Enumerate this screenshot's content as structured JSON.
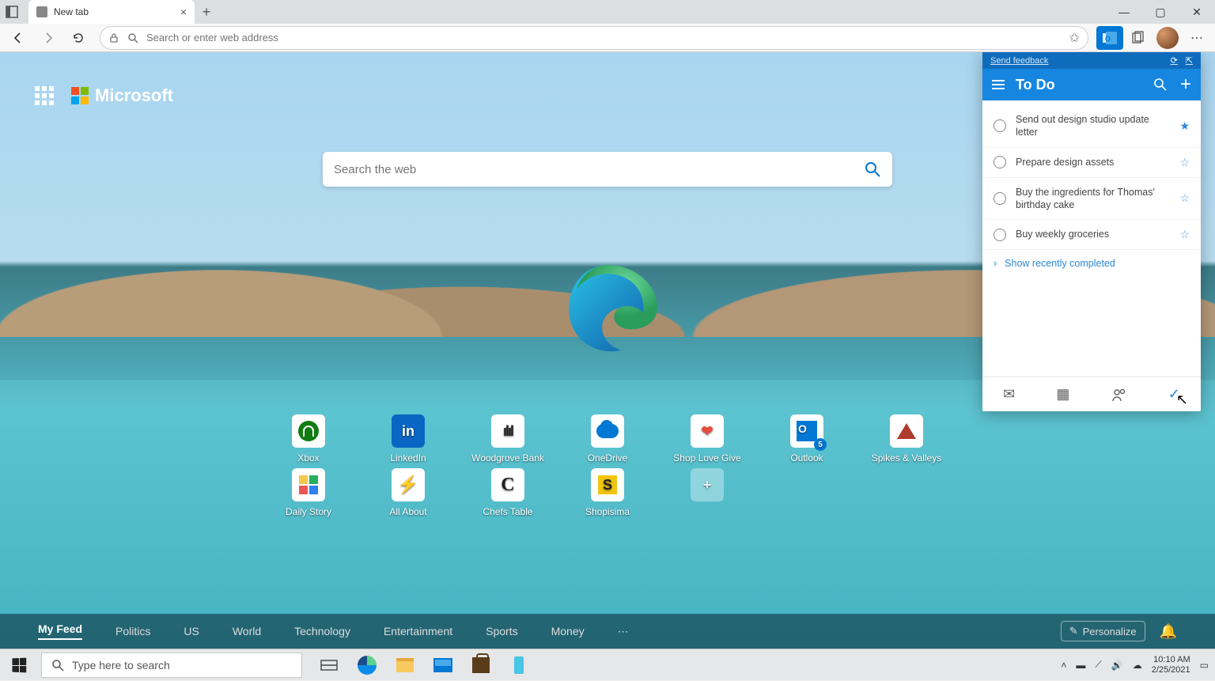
{
  "titlebar": {
    "tab_title": "New tab"
  },
  "toolbar": {
    "address_placeholder": "Search or enter web address"
  },
  "header": {
    "brand": "Microsoft"
  },
  "search": {
    "placeholder": "Search the web"
  },
  "tiles": {
    "row1": [
      {
        "label": "Xbox"
      },
      {
        "label": "LinkedIn"
      },
      {
        "label": "Woodgrove Bank"
      },
      {
        "label": "OneDrive"
      },
      {
        "label": "Shop Love Give"
      },
      {
        "label": "Outlook",
        "badge": "5"
      },
      {
        "label": "Spikes & Valleys"
      }
    ],
    "row2": [
      {
        "label": "Daily Story"
      },
      {
        "label": "All About"
      },
      {
        "label": "Chefs Table"
      },
      {
        "label": "Shopisima"
      }
    ]
  },
  "feed": {
    "tabs": [
      "My Feed",
      "Politics",
      "US",
      "World",
      "Technology",
      "Entertainment",
      "Sports",
      "Money"
    ],
    "personalize": "Personalize"
  },
  "todo": {
    "feedback": "Send feedback",
    "title": "To Do",
    "items": [
      {
        "text": "Send out design studio update letter",
        "starred": true
      },
      {
        "text": "Prepare design assets",
        "starred": false
      },
      {
        "text": "Buy the ingredients for Thomas' birthday cake",
        "starred": false
      },
      {
        "text": "Buy weekly groceries",
        "starred": false
      }
    ],
    "show_completed": "Show recently completed"
  },
  "taskbar": {
    "search_placeholder": "Type here to search",
    "time": "10:10 AM",
    "date": "2/25/2021"
  }
}
